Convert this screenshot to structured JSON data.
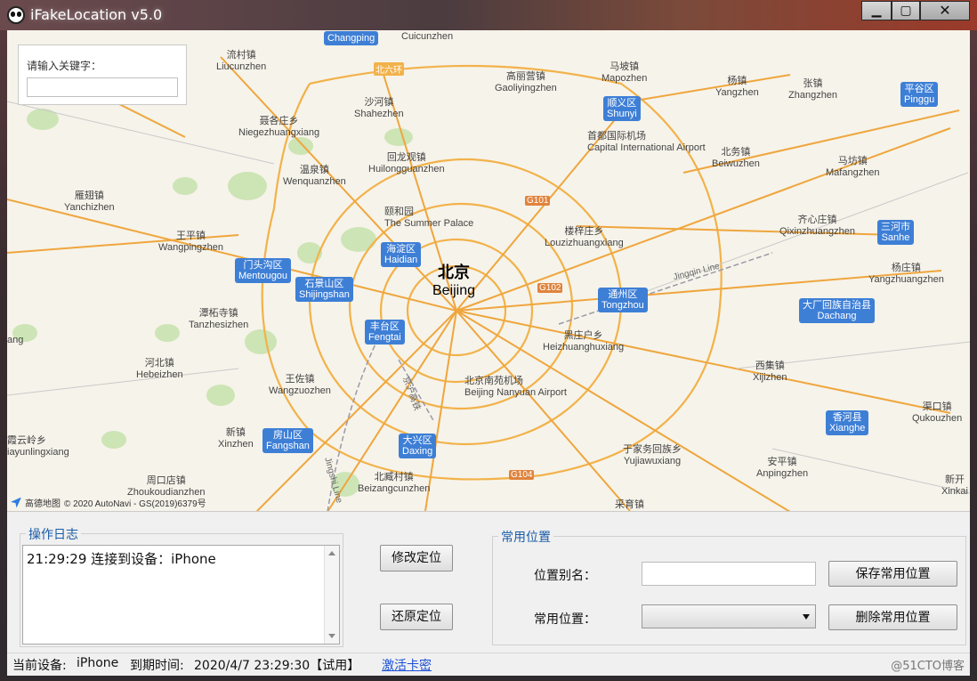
{
  "window": {
    "title": "iFakeLocation v5.0"
  },
  "search": {
    "label": "请输入关键字：",
    "value": ""
  },
  "map": {
    "city": {
      "cn": "北京",
      "en": "Beijing"
    },
    "places": [
      {
        "cn": "流村镇",
        "py": "Liucunzhen"
      },
      {
        "cn": "沙河镇",
        "py": "Shahezhen"
      },
      {
        "cn": "高丽营镇",
        "py": "Gaoliyingzhen"
      },
      {
        "cn": "马坡镇",
        "py": "Mapozhen"
      },
      {
        "cn": "杨镇",
        "py": "Yangzhen"
      },
      {
        "cn": "张镇",
        "py": "Zhangzhen"
      },
      {
        "cn": "聂各庄乡",
        "py": "Niegezhuangxiang"
      },
      {
        "cn": "首都国际机场",
        "py": "Capital International Airport"
      },
      {
        "cn": "北务镇",
        "py": "Beiwuzhen"
      },
      {
        "cn": "马坊镇",
        "py": "Mafangzhen"
      },
      {
        "cn": "温泉镇",
        "py": "Wenquanzhen"
      },
      {
        "cn": "回龙观镇",
        "py": "Huilongguanzhen"
      },
      {
        "cn": "雁翅镇",
        "py": "Yanchizhen"
      },
      {
        "cn": "颐和园",
        "py": "The Summer Palace"
      },
      {
        "cn": "楼梓庄乡",
        "py": "Louzizhuangxiang"
      },
      {
        "cn": "齐心庄镇",
        "py": "Qixinzhuangzhen"
      },
      {
        "cn": "王平镇",
        "py": "Wangpingzhen"
      },
      {
        "cn": "杨庄镇",
        "py": "Yangzhuangzhen"
      },
      {
        "cn": "潭柘寺镇",
        "py": "Tanzhesizhen"
      },
      {
        "cn": "黑庄户乡",
        "py": "Heizhuanghuxiang"
      },
      {
        "cn": "河北镇",
        "py": "Hebeizhen"
      },
      {
        "cn": "王佐镇",
        "py": "Wangzuozhen"
      },
      {
        "cn": "北京南苑机场",
        "py": "Beijing Nanyuan Airport"
      },
      {
        "cn": "西集镇",
        "py": "Xijizhen"
      },
      {
        "cn": "渠口镇",
        "py": "Qukouzhen"
      },
      {
        "cn": "霞云岭乡",
        "py": "iayunlingxiang"
      },
      {
        "cn": "新镇",
        "py": "Xinzhen"
      },
      {
        "cn": "于家务回族乡",
        "py": "Yujiawuxiang"
      },
      {
        "cn": "安平镇",
        "py": "Anpingzhen"
      },
      {
        "cn": "周口店镇",
        "py": "Zhoukoudianzhen"
      },
      {
        "cn": "北臧村镇",
        "py": "Beizangcunzhen"
      },
      {
        "cn": "采育镇",
        "py": ""
      },
      {
        "cn": "新开",
        "py": "Xinkai"
      },
      {
        "cn": "",
        "py": "Cuicunzhen"
      },
      {
        "cn": "",
        "py": "ang"
      }
    ],
    "districts": [
      {
        "cn": "",
        "py": "Changping"
      },
      {
        "cn": "顺义区",
        "py": "Shunyi"
      },
      {
        "cn": "平谷区",
        "py": "Pinggu"
      },
      {
        "cn": "海淀区",
        "py": "Haidian"
      },
      {
        "cn": "门头沟区",
        "py": "Mentougou"
      },
      {
        "cn": "石景山区",
        "py": "Shijingshan"
      },
      {
        "cn": "通州区",
        "py": "Tongzhou"
      },
      {
        "cn": "三河市",
        "py": "Sanhe"
      },
      {
        "cn": "大厂回族自治县",
        "py": "Dachang"
      },
      {
        "cn": "丰台区",
        "py": "Fengtai"
      },
      {
        "cn": "房山区",
        "py": "Fangshan"
      },
      {
        "cn": "大兴区",
        "py": "Daxing"
      },
      {
        "cn": "香河县",
        "py": "Xianghe"
      }
    ],
    "roads": {
      "ring6": "北六环",
      "g101": "G101",
      "g102": "G102",
      "g104": "G104",
      "jingqin": "Jingqin Line",
      "jinghu": "京沪高铁",
      "jingshi": "Jingshi Line"
    },
    "credit": {
      "brand": "高德地图",
      "text": "© 2020 AutoNavi - GS(2019)6379号"
    }
  },
  "log": {
    "title": "操作日志",
    "entries": [
      "21:29:29  连接到设备：iPhone"
    ]
  },
  "actions": {
    "modify": "修改定位",
    "restore": "还原定位"
  },
  "favorites": {
    "title": "常用位置",
    "alias_label": "位置别名：",
    "alias_value": "",
    "list_label": "常用位置：",
    "selected": "",
    "save": "保存常用位置",
    "delete": "删除常用位置"
  },
  "status": {
    "device_label": "当前设备:",
    "device": "iPhone",
    "expiry_label": "到期时间:",
    "expiry": "2020/4/7 23:29:30【试用】",
    "activate": "激活卡密",
    "watermark": "@51CTO博客"
  }
}
